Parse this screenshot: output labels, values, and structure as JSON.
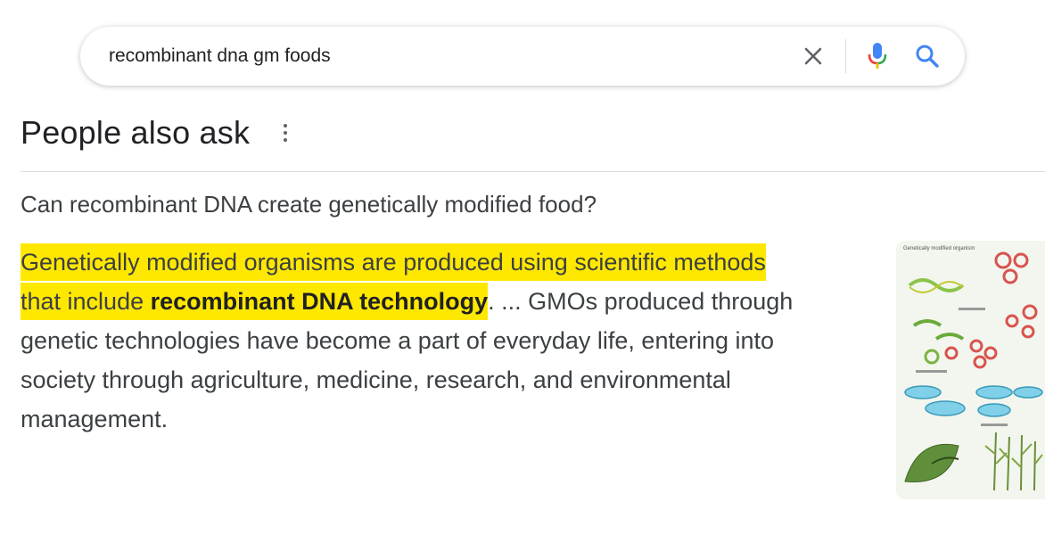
{
  "search": {
    "query": "recombinant dna gm foods",
    "icons": {
      "clear": "close-icon",
      "voice": "microphone-icon",
      "search": "search-icon"
    }
  },
  "people_also_ask": {
    "title": "People also ask",
    "more_icon": "more-vert-icon",
    "question": "Can recombinant DNA create genetically modified food?",
    "answer": {
      "highlight_line1": "Genetically modified organisms are produced using scientific methods",
      "highlight_line2_prefix": "that include ",
      "highlight_bold": "recombinant DNA technology",
      "rest": ". ... GMOs produced through genetic technologies have become a part of everyday life, entering into society through agriculture, medicine, research, and environmental management."
    },
    "thumbnail_caption": "Genetically modified organism"
  },
  "colors": {
    "highlight": "#ffe800",
    "mic_blue": "#4285f4",
    "mic_red": "#ea4335",
    "mic_yellow": "#fbbc04",
    "mic_green": "#34a853",
    "search_blue": "#4285f4"
  }
}
